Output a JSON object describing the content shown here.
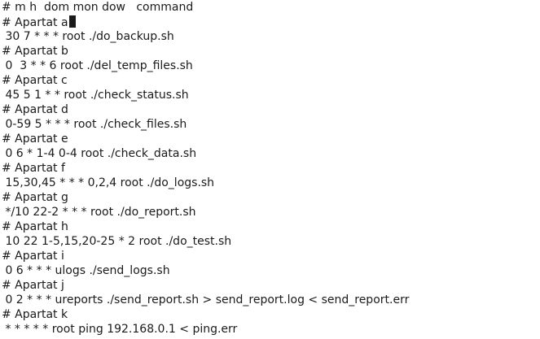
{
  "terminal": {
    "lines": [
      "# m h  dom mon dow   command",
      "# Apartat a",
      " 30 7 * * * root ./do_backup.sh",
      "# Apartat b",
      " 0  3 * * 6 root ./del_temp_files.sh",
      "# Apartat c",
      " 45 5 1 * * root ./check_status.sh",
      "# Apartat d",
      " 0-59 5 * * * root ./check_files.sh",
      "# Apartat e",
      " 0 6 * 1-4 0-4 root ./check_data.sh",
      "# Apartat f",
      " 15,30,45 * * * 0,2,4 root ./do_logs.sh",
      "# Apartat g",
      " */10 22-2 * * * root ./do_report.sh",
      "# Apartat h",
      " 10 22 1-5,15,20-25 * 2 root ./do_test.sh",
      "# Apartat i",
      " 0 6 * * * ulogs ./send_logs.sh",
      "# Apartat j",
      " 0 2 * * * ureports ./send_report.sh > send_report.log < send_report.err",
      "# Apartat k",
      " * * * * * root ping 192.168.0.1 < ping.err"
    ]
  }
}
